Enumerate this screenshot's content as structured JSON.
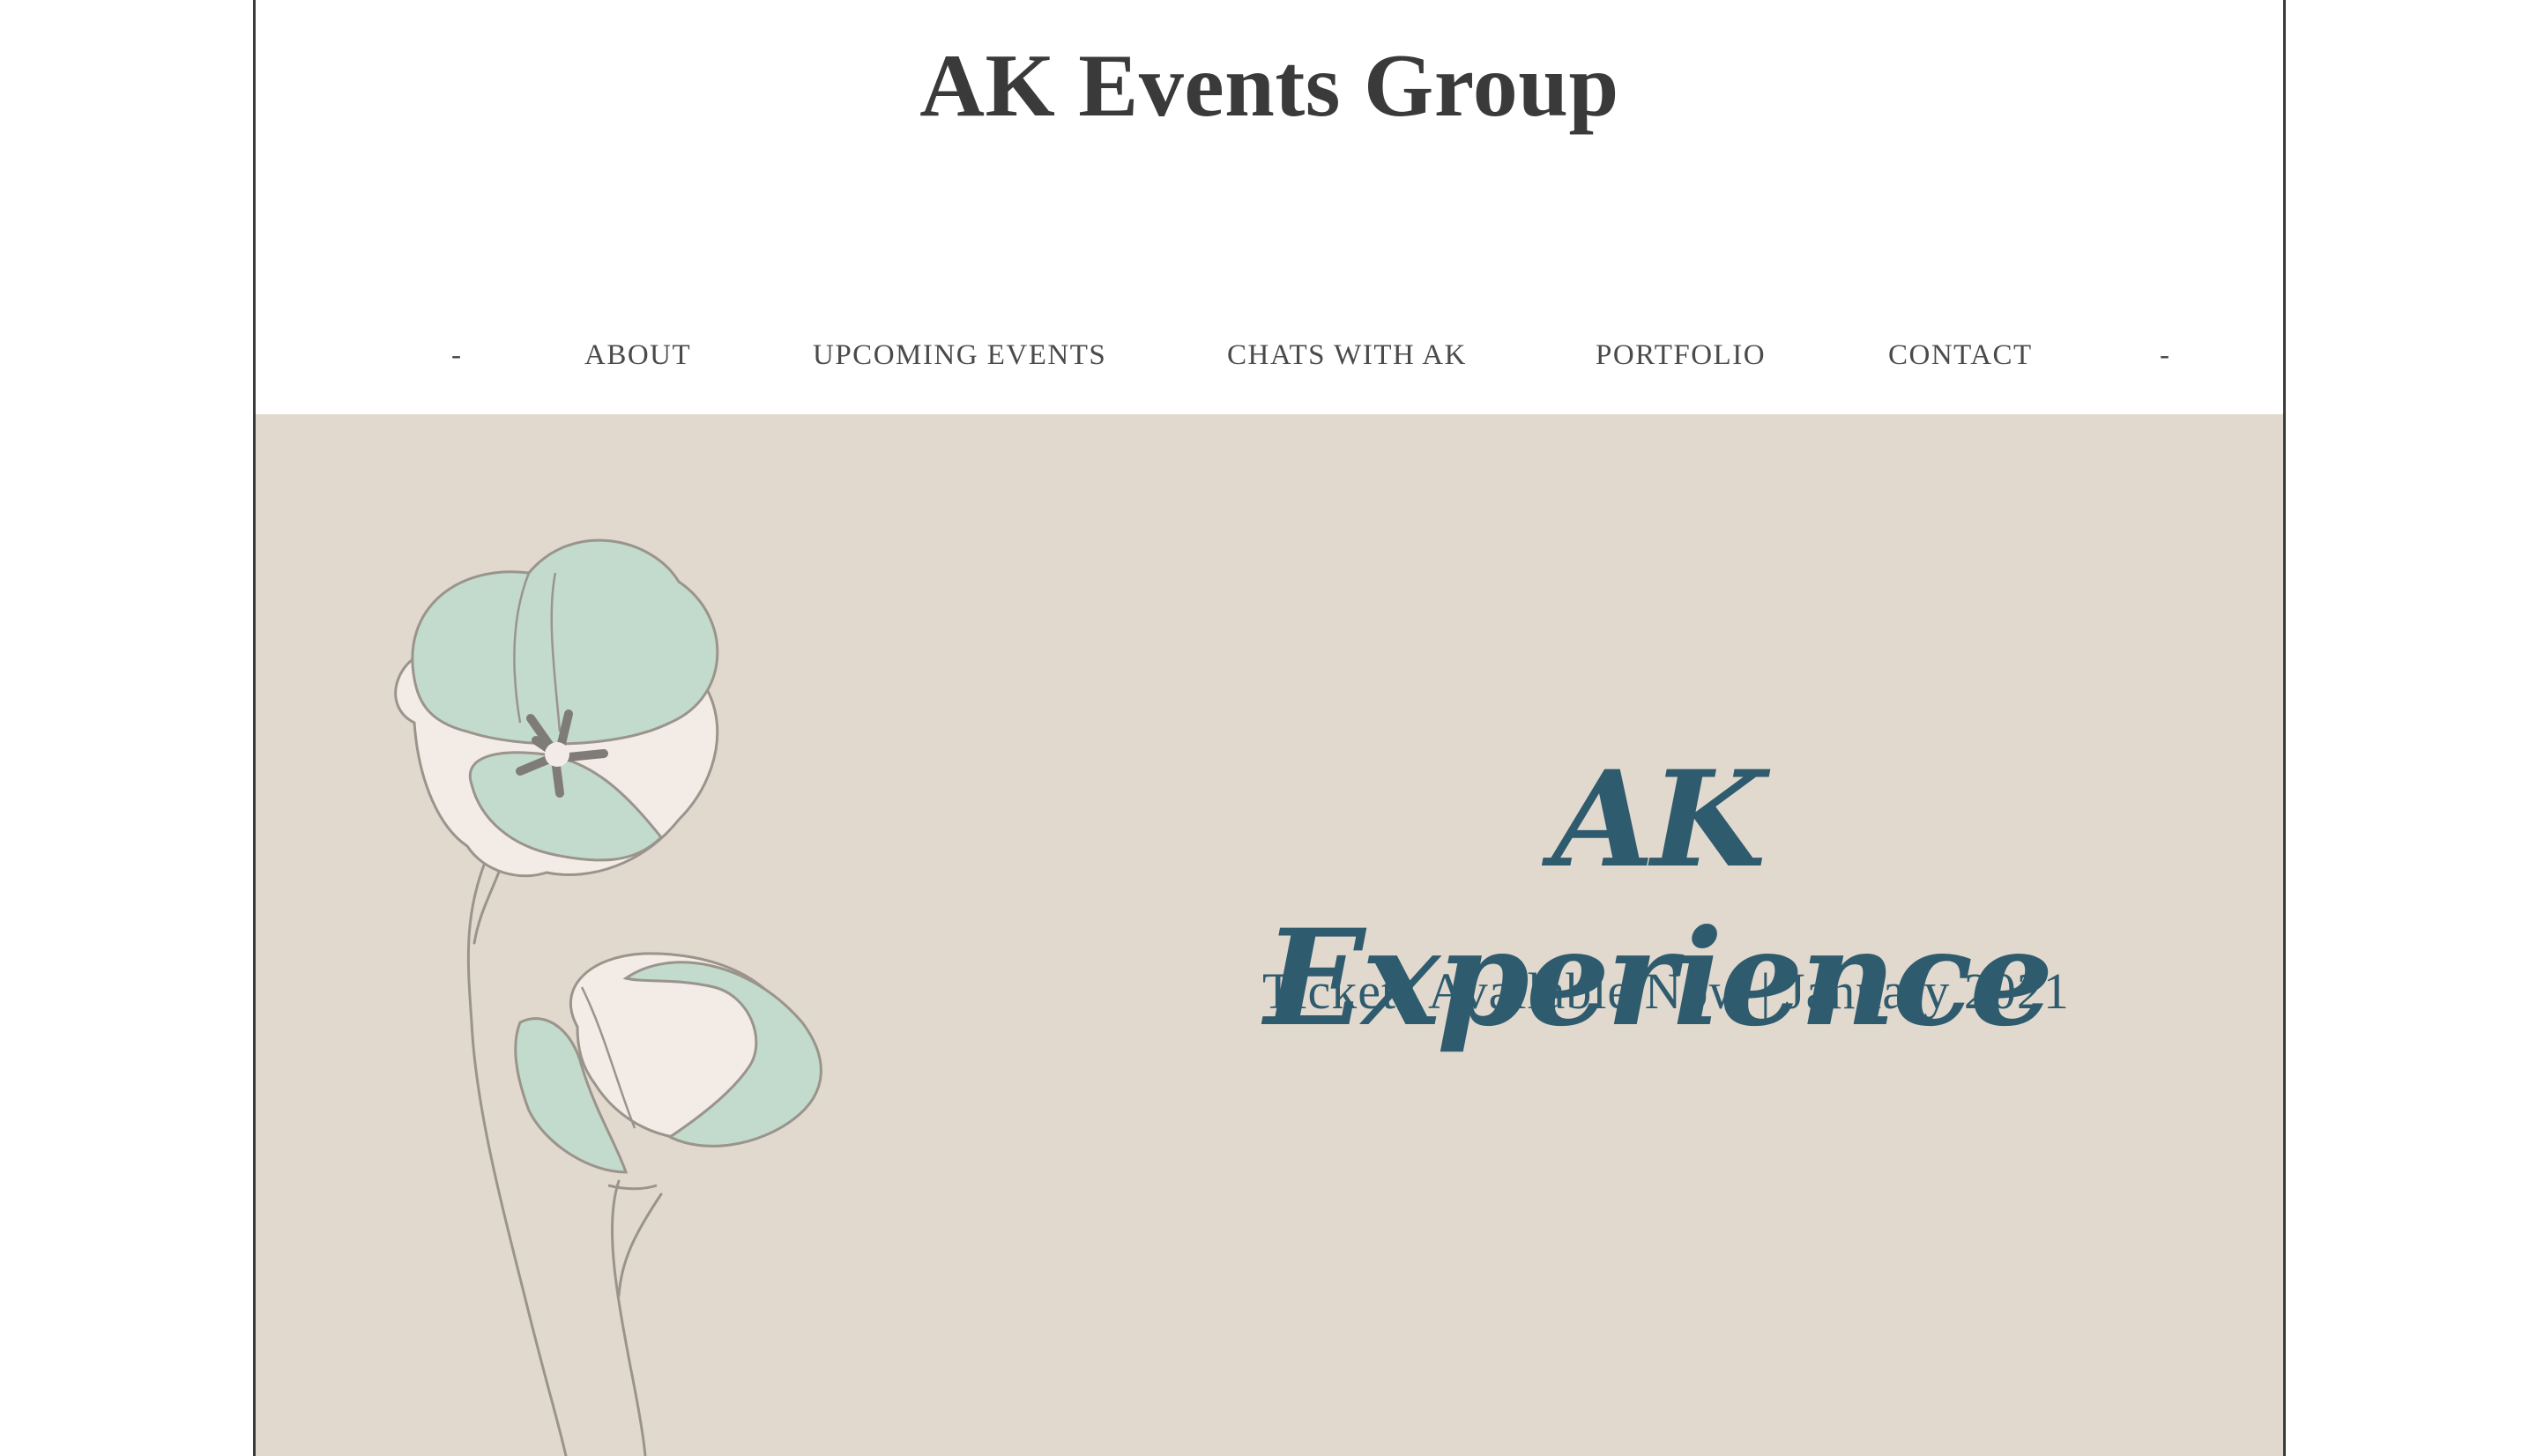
{
  "site": {
    "title": "AK Events Group"
  },
  "nav": {
    "items": [
      {
        "label": "-"
      },
      {
        "label": "ABOUT"
      },
      {
        "label": "UPCOMING EVENTS"
      },
      {
        "label": "CHATS WITH AK"
      },
      {
        "label": "PORTFOLIO"
      },
      {
        "label": "CONTACT"
      },
      {
        "label": "-"
      }
    ]
  },
  "hero": {
    "script_title": "AK Experience",
    "tagline": "Tickets Available Now | January 2021",
    "background_color": "#e1d9ce",
    "text_color": "#2f5b6e",
    "illustration": "poppy-flowers-line-art",
    "petal_color": "#c2dbcc",
    "inner_petal_color": "#f3ece6"
  }
}
